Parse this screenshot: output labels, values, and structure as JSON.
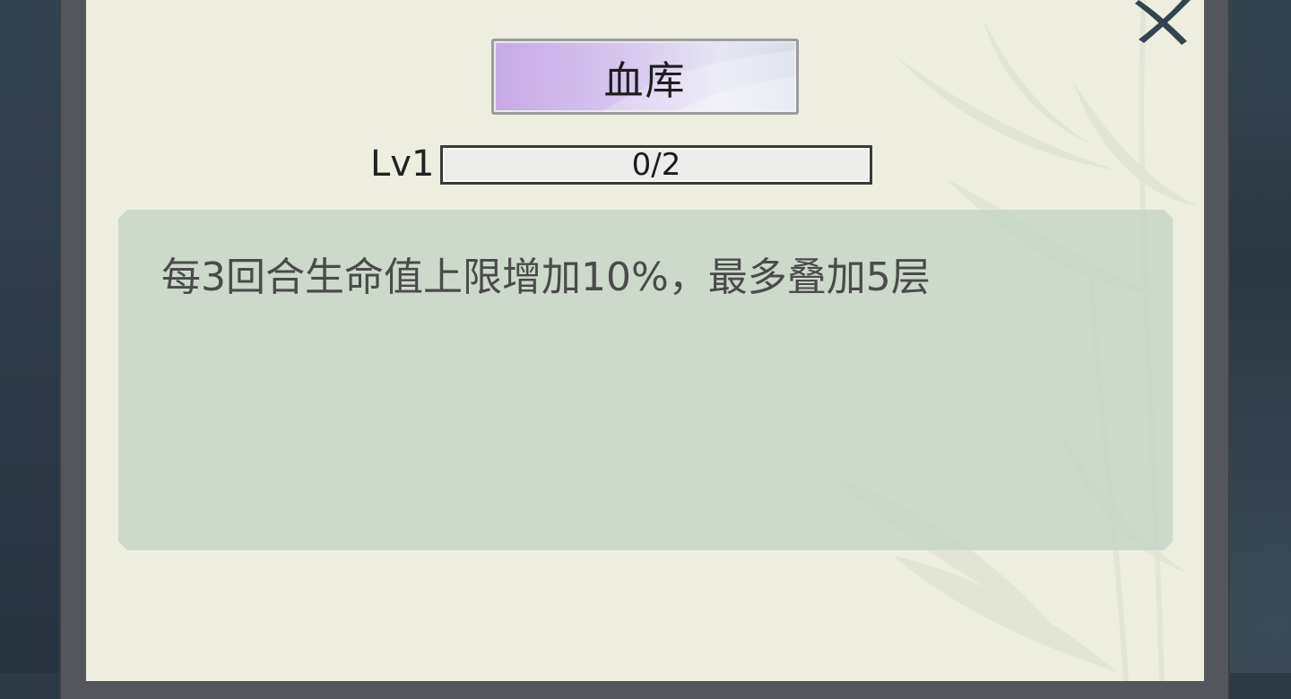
{
  "skill": {
    "name": "血库",
    "level_label": "Lv1",
    "progress_text": "0/2",
    "progress_current": 0,
    "progress_max": 2,
    "description": "每3回合生命值上限增加10%，最多叠加5层"
  },
  "close_button": {
    "icon": "close-x-icon"
  },
  "colors": {
    "title_gradient_start": "#c7a9e6",
    "title_gradient_end": "#d7dcea",
    "paper": "#edeee0",
    "description_panel": "#c4d4c6",
    "close_icon": "#33434f"
  }
}
